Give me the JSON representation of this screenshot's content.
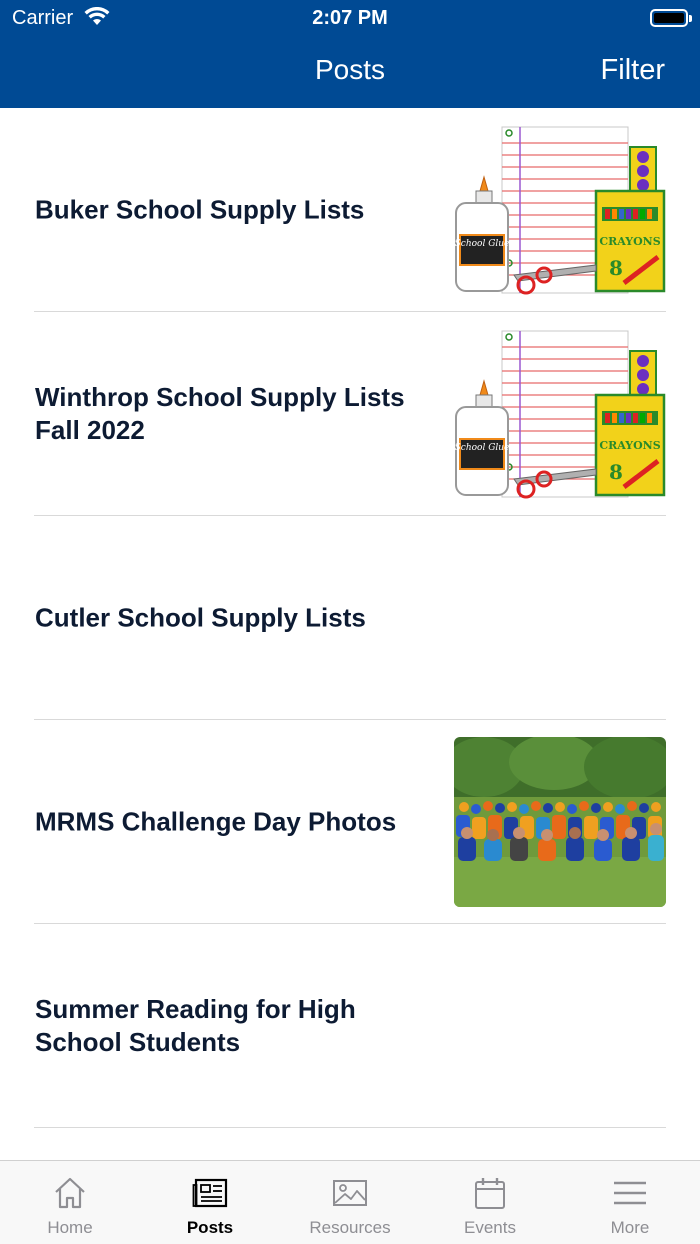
{
  "status_bar": {
    "carrier": "Carrier",
    "time": "2:07 PM"
  },
  "nav": {
    "title": "Posts",
    "filter_label": "Filter"
  },
  "posts": [
    {
      "title": "Buker School Supply Lists",
      "thumbnail": "school-supplies-image"
    },
    {
      "title": "Winthrop School Supply Lists Fall 2022",
      "thumbnail": "school-supplies-image"
    },
    {
      "title": "Cutler School Supply Lists",
      "thumbnail": ""
    },
    {
      "title": "MRMS Challenge Day Photos",
      "thumbnail": "challenge-day-photo"
    },
    {
      "title": "Summer Reading for High School Students",
      "thumbnail": ""
    }
  ],
  "supplies_image_text": {
    "glue": "School Glue",
    "crayons_brand": "CRAYONS",
    "crayons_count": "8"
  },
  "tabs": [
    {
      "label": "Home",
      "icon": "house-icon",
      "active": false
    },
    {
      "label": "Posts",
      "icon": "newspaper-icon",
      "active": true
    },
    {
      "label": "Resources",
      "icon": "image-icon",
      "active": false
    },
    {
      "label": "Events",
      "icon": "calendar-icon",
      "active": false
    },
    {
      "label": "More",
      "icon": "menu-icon",
      "active": false
    }
  ],
  "colors": {
    "header": "#004a94",
    "title_text": "#0d1b33",
    "tab_inactive": "#8e8e93",
    "tab_active": "#000000"
  }
}
